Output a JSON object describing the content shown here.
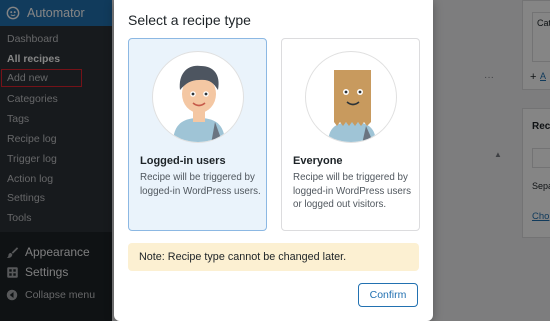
{
  "sidebar": {
    "header": {
      "icon": "automator-icon",
      "label": "Automator"
    },
    "submenu": [
      {
        "label": "Dashboard"
      },
      {
        "label": "All recipes"
      },
      {
        "label": "Add new"
      },
      {
        "label": "Categories"
      },
      {
        "label": "Tags"
      },
      {
        "label": "Recipe log"
      },
      {
        "label": "Trigger log"
      },
      {
        "label": "Action log"
      },
      {
        "label": "Settings"
      },
      {
        "label": "Tools"
      }
    ],
    "main": [
      {
        "icon": "paintbrush-icon",
        "label": "Appearance"
      },
      {
        "icon": "settings-icon",
        "label": "Settings"
      }
    ],
    "collapse": {
      "icon": "collapse-arrow-icon",
      "label": "Collapse menu"
    }
  },
  "background": {
    "right_top_label": "Cat",
    "right_middle_label": "Rec",
    "right_separator_label": "Sepa",
    "right_link_label": "Cho"
  },
  "modal": {
    "title": "Select a recipe type",
    "options": [
      {
        "title": "Logged-in users",
        "description": "Recipe will be triggered by logged-in WordPress users.",
        "selected": true
      },
      {
        "title": "Everyone",
        "description": "Recipe will be triggered by logged-in WordPress users or logged out visitors.",
        "selected": false
      }
    ],
    "note": "Note: Recipe type cannot be changed later.",
    "confirm_label": "Confirm"
  },
  "colors": {
    "sidebar_bg": "#1d2327",
    "submenu_bg": "#2c3338",
    "accent": "#2271b1",
    "note_bg": "#fcf0d2",
    "selected_bg": "#eaf3fb"
  }
}
